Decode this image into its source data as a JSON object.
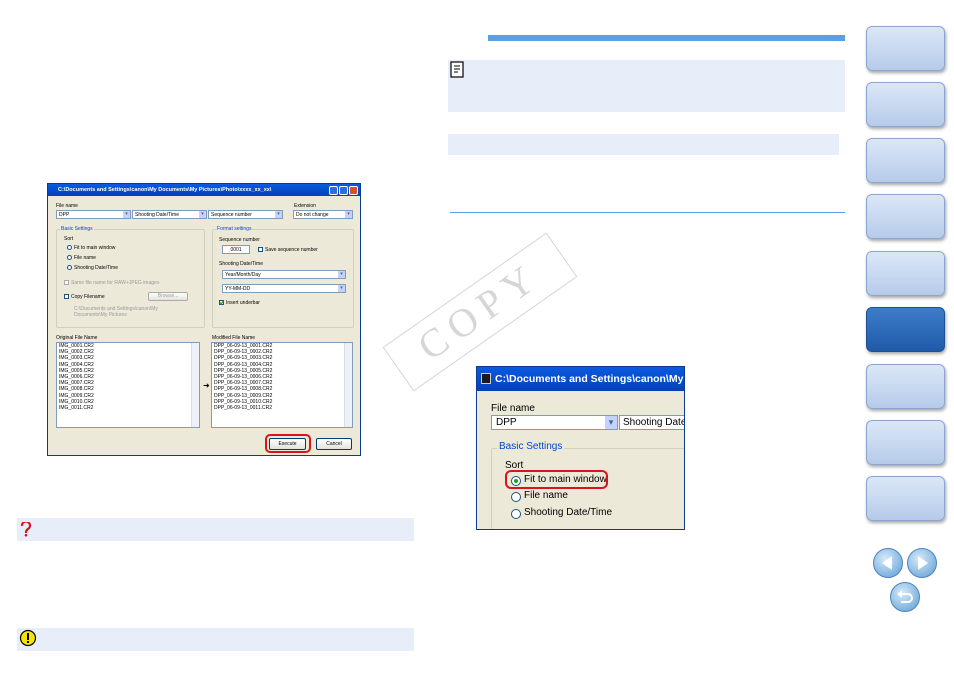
{
  "colors": {
    "accent": "#5aa0e6",
    "band": "#e7eef9",
    "highlight": "#d9141b",
    "tab_active": "#2a66b5"
  },
  "dialog": {
    "title": "C:\\Documents and Settings\\canon\\My Documents\\My Pictures\\Photo\\xxxx_xx_xx\\",
    "file_name_label": "File name",
    "combo1": "DPP",
    "combo2": "Shooting Date/Time",
    "combo3": "Sequence number",
    "extension_label": "Extension",
    "extension_value": "Do not change",
    "basic_settings": "Basic Settings",
    "sort_label": "Sort",
    "sort_options": [
      "Fit to main window",
      "File name",
      "Shooting Date/Time"
    ],
    "same_file_name": "Same file name for RAW+JPEG images",
    "copy_filename": "Copy Filename",
    "browse": "Browse...",
    "copy_path": "C:\\Documents and Settings\\canon\\My Documents\\My Pictures",
    "format_settings": "Format settings",
    "sequence_number_label": "Sequence number",
    "sequence_value": "0001",
    "save_sequence": "Save sequence number",
    "shooting_date_label": "Shooting Date/Time",
    "date_format1": "Year/Month/Day",
    "date_format2": "YY-MM-DD",
    "insert_underbar": "Insert underbar",
    "original_label": "Original File Name",
    "modified_label": "Modified File Name",
    "original_files": [
      "IMG_0001.CR2",
      "IMG_0002.CR2",
      "IMG_0003.CR2",
      "IMG_0004.CR2",
      "IMG_0005.CR2",
      "IMG_0006.CR2",
      "IMG_0007.CR2",
      "IMG_0008.CR2",
      "IMG_0009.CR2",
      "IMG_0010.CR2",
      "IMG_0011.CR2"
    ],
    "modified_files": [
      "DPP_06-09-13_0001.CR2",
      "DPP_06-09-13_0002.CR2",
      "DPP_06-09-13_0003.CR2",
      "DPP_06-09-13_0004.CR2",
      "DPP_06-09-13_0005.CR2",
      "DPP_06-09-13_0006.CR2",
      "DPP_06-09-13_0007.CR2",
      "DPP_06-09-13_0008.CR2",
      "DPP_06-09-13_0009.CR2",
      "DPP_06-09-13_0010.CR2",
      "DPP_06-09-13_0011.CR2"
    ],
    "execute": "Execute",
    "cancel": "Cancel"
  },
  "zoom": {
    "title": "C:\\Documents and Settings\\canon\\My Do",
    "file_name_label": "File name",
    "combo1": "DPP",
    "combo2": "Shooting Date/",
    "basic_settings": "Basic Settings",
    "sort_label": "Sort",
    "options": [
      "Fit to main window",
      "File name",
      "Shooting Date/Time"
    ]
  },
  "watermark": "COPY",
  "icons": {
    "question": "question-icon",
    "caution": "caution-icon",
    "memo": "memo-icon",
    "prev": "arrow-left-icon",
    "next": "arrow-right-icon",
    "back": "return-icon"
  }
}
